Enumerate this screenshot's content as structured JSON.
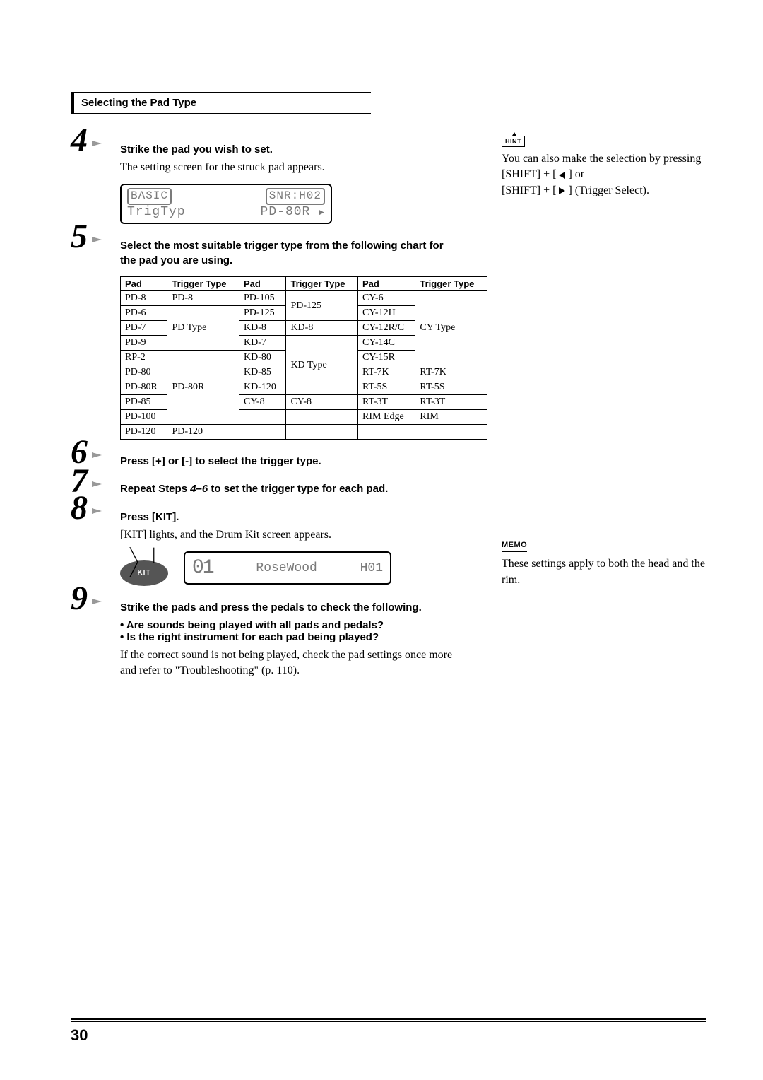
{
  "section_header": "Selecting the Pad Type",
  "steps": {
    "s4": {
      "num": "4",
      "title": "Strike the pad you wish to set.",
      "body": "The setting screen for the struck pad appears.",
      "lcd": {
        "top_left": "BASIC",
        "top_right": "SNR:H02",
        "bottom_left": "TrigTyp",
        "bottom_right": "PD-80R"
      }
    },
    "s5": {
      "num": "5",
      "title": "Select the most suitable trigger type from the following chart for the pad you are using."
    },
    "s6": {
      "num": "6",
      "title": "Press [+] or [-] to select the trigger type."
    },
    "s7": {
      "num": "7",
      "repeat_pre": "Repeat Steps ",
      "repeat_range": "4–6",
      "repeat_post": " to set the trigger type for each pad."
    },
    "s8": {
      "num": "8",
      "title": "Press [KIT].",
      "body": "[KIT] lights, and the Drum Kit screen appears.",
      "button_label": "KIT",
      "lcd": {
        "big": "01",
        "name": "RoseWood",
        "code": "H01"
      }
    },
    "s9": {
      "num": "9",
      "title": "Strike the pads and press the pedals to check the following.",
      "bullet1": "• Are sounds being played with all pads and pedals?",
      "bullet2": "• Is the right instrument for each pad being played?",
      "body": "If the correct sound is not being played, check the pad settings once more and refer to \"Troubleshooting\" (p. 110)."
    }
  },
  "table": {
    "headers": [
      "Pad",
      "Trigger Type",
      "Pad",
      "Trigger Type",
      "Pad",
      "Trigger Type"
    ],
    "col1_pads": [
      "PD-8",
      "PD-6",
      "PD-7",
      "PD-9",
      "RP-2",
      "PD-80",
      "PD-80R",
      "PD-85",
      "PD-100",
      "PD-120"
    ],
    "col1_types": [
      "PD-8",
      "PD Type",
      "",
      "",
      "PD-80R",
      "",
      "",
      "",
      "",
      "PD-120"
    ],
    "col2_pads": [
      "PD-105",
      "PD-125",
      "KD-8",
      "KD-7",
      "KD-80",
      "KD-85",
      "KD-120",
      "CY-8",
      "",
      ""
    ],
    "col2_types": [
      "PD-125",
      "",
      "KD-8",
      "KD Type",
      "",
      "",
      "",
      "CY-8",
      "",
      ""
    ],
    "col3_pads": [
      "CY-6",
      "CY-12H",
      "CY-12R/C",
      "CY-14C",
      "CY-15R",
      "RT-7K",
      "RT-5S",
      "RT-3T",
      "RIM Edge",
      ""
    ],
    "col3_types": [
      "CY Type",
      "",
      "",
      "",
      "",
      "RT-7K",
      "RT-5S",
      "RT-3T",
      "RIM",
      ""
    ]
  },
  "hint": {
    "label": "HINT",
    "p1": "You can also make the selection by pressing",
    "p2a": "[SHIFT] + [ ",
    "p2b": " ] or",
    "p3a": "[SHIFT] + [ ",
    "p3b": " ] (Trigger Select)."
  },
  "memo": {
    "label": "MEMO",
    "text": "These settings apply to both the head and the rim."
  },
  "page_number": "30",
  "chart_data": {
    "type": "table",
    "title": "Trigger type chart",
    "columns": [
      "Pad",
      "Trigger Type"
    ],
    "rows": [
      [
        "PD-8",
        "PD-8"
      ],
      [
        "PD-6",
        "PD Type"
      ],
      [
        "PD-7",
        "PD Type"
      ],
      [
        "PD-9",
        "PD Type"
      ],
      [
        "RP-2",
        "PD-80R"
      ],
      [
        "PD-80",
        "PD-80R"
      ],
      [
        "PD-80R",
        "PD-80R"
      ],
      [
        "PD-85",
        "PD-80R"
      ],
      [
        "PD-100",
        "PD-80R"
      ],
      [
        "PD-120",
        "PD-120"
      ],
      [
        "PD-105",
        "PD-125"
      ],
      [
        "PD-125",
        "PD-125"
      ],
      [
        "KD-8",
        "KD-8"
      ],
      [
        "KD-7",
        "KD Type"
      ],
      [
        "KD-80",
        "KD Type"
      ],
      [
        "KD-85",
        "KD Type"
      ],
      [
        "KD-120",
        "KD Type"
      ],
      [
        "CY-8",
        "CY-8"
      ],
      [
        "CY-6",
        "CY Type"
      ],
      [
        "CY-12H",
        "CY Type"
      ],
      [
        "CY-12R/C",
        "CY Type"
      ],
      [
        "CY-14C",
        "CY Type"
      ],
      [
        "CY-15R",
        "CY Type"
      ],
      [
        "RT-7K",
        "RT-7K"
      ],
      [
        "RT-5S",
        "RT-5S"
      ],
      [
        "RT-3T",
        "RT-3T"
      ],
      [
        "RIM Edge",
        "RIM"
      ]
    ]
  }
}
